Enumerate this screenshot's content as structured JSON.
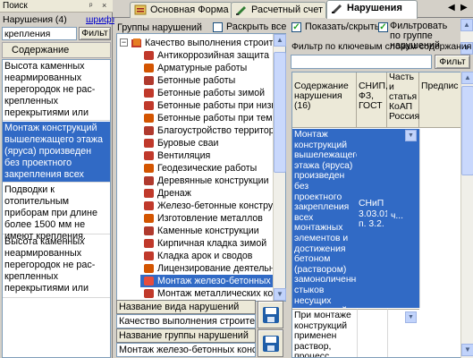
{
  "left_panel": {
    "title": "Поиск",
    "title_controls": "ᵖ ×",
    "violations_count": "Нарушения (4)",
    "font_link": "шрифт",
    "search_value": "крепления",
    "filter_button": "Фильт",
    "content_header": "Содержание",
    "items": [
      "Высота каменных неармированных перегородок не рас-крепленных перекрытиями или",
      "Монтаж конструкций вышележащего этажа (яруса) произведен без проектного закрепления всех",
      "Подводки к отопительным приборам при длине более 1500 мм не имеют крепления.",
      "Высота каменных неармированных перегородок не рас-крепленных перекрытиями или"
    ]
  },
  "tabs": [
    {
      "label": "Основная Форма",
      "icon": "form-icon"
    },
    {
      "label": "Расчетный счет",
      "icon": "account-icon"
    },
    {
      "label": "Нарушения",
      "icon": "violations-icon",
      "active": true
    }
  ],
  "middle": {
    "groups_label": "Группы нарушений",
    "expand_all_label": "Раскрыть все",
    "root": "Качество выполнения строитель",
    "tree_items": [
      "Антикоррозийная защита",
      "Арматурные работы",
      "Бетонные работы",
      "Бетонные работы зимой",
      "Бетонные работы при низких",
      "Бетонные работы при темпе",
      "Благоустройство территор",
      "Буровые сваи",
      "Вентиляция",
      "Геодезические работы",
      "Деревянные конструкции",
      "Дренаж",
      "Железо-бетонные конструк",
      "Изготовление металлов",
      "Каменные конструкции",
      "Кирпичная кладка зимой",
      "Кладка арок и сводов",
      "Лицензирование деятельно",
      "Монтаж железо-бетонных к",
      "Монтаж металлических кон"
    ],
    "selected_index": 18,
    "violation_type_label": "Название вида нарушений",
    "violation_type_value": "Качество выполнения строительн",
    "group_name_label": "Название группы нарушений",
    "group_name_value": "Монтаж железо-бетонных констру"
  },
  "right": {
    "show_hide_label": "Показать/скрыть",
    "show_hide_checked": true,
    "filter_by_group_label": "Фильтровать по группе нарушений",
    "filter_by_group_checked": true,
    "keyword_label": "Фильтр по ключевым словам содержания нару",
    "filter_button": "Фильт",
    "grid_headers": [
      "Содержание нарушения (16)",
      "СНИП, ФЗ, ГОСТ",
      "Часть и статья КоАП Россия",
      "Предпис"
    ],
    "rows": [
      {
        "content": "Монтаж конструкций вышележащего этажа (яруса) произведен без проектного закрепления всех монтажных элементов и достижения бетоном (раствором) замоноличенных стыков несущих конструкций",
        "snip": "СНиП 3.03.01- п. 3.2.",
        "part": "ч...",
        "selected": true
      },
      {
        "content": "При монтаже конструкций применен раствор, процесс",
        "snip": "",
        "part": "",
        "selected": false
      }
    ]
  }
}
